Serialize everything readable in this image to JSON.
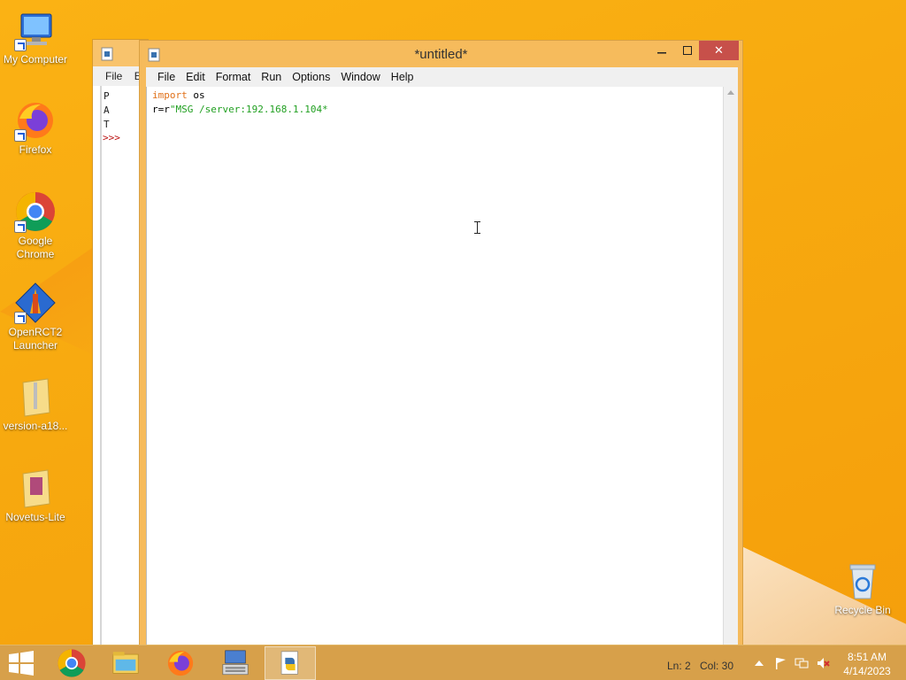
{
  "desktop": {
    "icons": [
      {
        "label": "My Computer"
      },
      {
        "label": "Firefox"
      },
      {
        "label": "Google Chrome"
      },
      {
        "label": "OpenRCT2 Launcher"
      },
      {
        "label": "version-a18..."
      },
      {
        "label": "Novetus-Lite"
      },
      {
        "label": "Recycle Bin"
      }
    ]
  },
  "shell": {
    "menu_first": "File",
    "menu_second": "E",
    "lines": [
      "P",
      "A",
      "T"
    ],
    "prompt": ">>>"
  },
  "editor": {
    "title": "*untitled*",
    "close_glyph": "✕",
    "menu": [
      "File",
      "Edit",
      "Format",
      "Run",
      "Options",
      "Window",
      "Help"
    ],
    "code": {
      "line1_kw": "import",
      "line1_rest": " os",
      "line2_prefix": "r=r",
      "line2_string": "\"MSG /server:192.168.1.104*"
    }
  },
  "taskbar": {
    "status_ln": "Ln: 2",
    "status_col": "Col: 30",
    "clock_time": "8:51 AM",
    "clock_date": "4/14/2023"
  },
  "colors": {
    "keyword": "#e0711a",
    "string": "#22a022",
    "close_button": "#c7504a",
    "taskbar": "#d7a04a"
  }
}
